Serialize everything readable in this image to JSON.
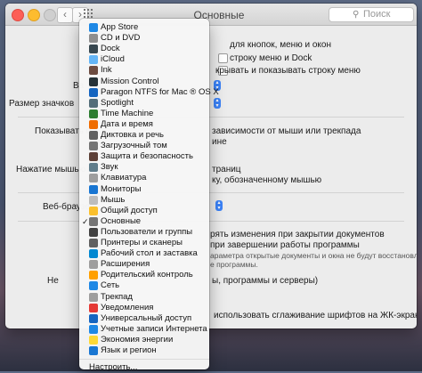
{
  "window": {
    "title": "Основные",
    "search_placeholder": "Поиск"
  },
  "pane": {
    "appearance_hint": "для кнопок, меню и окон",
    "dark_menu": "строку меню и Dock",
    "autohide": "крывать и показывать строку меню",
    "highlight_label": "Ва",
    "sidebar_size_label": "Размер значков",
    "scroll_label": "Показывать п",
    "scroll_value": "зависимости от мыши или трекпада",
    "scroll_value2": "ине",
    "click_label": "Нажатие мышью по",
    "click_value": "траниц",
    "click_value2": "ку, обозначенному мышью",
    "browser_label": "Веб-браузе",
    "ask_save": "рять изменения при закрытии документов",
    "close_windows": "при завершении работы программы",
    "restore_note_1": "араметра открытые документы и окна не будут восстановлены при",
    "restore_note_2": "е программы.",
    "recent_label": "Не",
    "recent_value": "ы, программы и серверы)",
    "font_smoothing": "использовать сглаживание шрифтов на ЖК-экране"
  },
  "menu": {
    "items": [
      {
        "label": "App Store",
        "icon": "app-store-icon",
        "color": "#1e88e5"
      },
      {
        "label": "CD и DVD",
        "icon": "cd-dvd-icon",
        "color": "#8e8e8e"
      },
      {
        "label": "Dock",
        "icon": "dock-icon",
        "color": "#37474f"
      },
      {
        "label": "iCloud",
        "icon": "icloud-icon",
        "color": "#64b5f6"
      },
      {
        "label": "Ink",
        "icon": "ink-icon",
        "color": "#6d4c41"
      },
      {
        "label": "Mission Control",
        "icon": "mission-control-icon",
        "color": "#263238"
      },
      {
        "label": "Paragon NTFS for Mac ® OS X",
        "icon": "paragon-ntfs-icon",
        "color": "#1565c0"
      },
      {
        "label": "Spotlight",
        "icon": "spotlight-icon",
        "color": "#546e7a"
      },
      {
        "label": "Time Machine",
        "icon": "time-machine-icon",
        "color": "#2e7d32"
      },
      {
        "label": "Дата и время",
        "icon": "date-time-icon",
        "color": "#ef6c00"
      },
      {
        "label": "Диктовка и речь",
        "icon": "dictation-icon",
        "color": "#616161"
      },
      {
        "label": "Загрузочный том",
        "icon": "startup-disk-icon",
        "color": "#757575"
      },
      {
        "label": "Защита и безопасность",
        "icon": "security-icon",
        "color": "#5d4037"
      },
      {
        "label": "Звук",
        "icon": "sound-icon",
        "color": "#607d8b"
      },
      {
        "label": "Клавиатура",
        "icon": "keyboard-icon",
        "color": "#9e9e9e"
      },
      {
        "label": "Мониторы",
        "icon": "displays-icon",
        "color": "#1976d2"
      },
      {
        "label": "Мышь",
        "icon": "mouse-icon",
        "color": "#bdbdbd"
      },
      {
        "label": "Общий доступ",
        "icon": "sharing-icon",
        "color": "#fbc02d"
      },
      {
        "label": "Основные",
        "icon": "general-icon",
        "color": "#757575",
        "checked": "✓"
      },
      {
        "label": "Пользователи и группы",
        "icon": "users-groups-icon",
        "color": "#424242"
      },
      {
        "label": "Принтеры и сканеры",
        "icon": "printers-icon",
        "color": "#616161"
      },
      {
        "label": "Рабочий стол и заставка",
        "icon": "desktop-icon",
        "color": "#0288d1"
      },
      {
        "label": "Расширения",
        "icon": "extensions-icon",
        "color": "#9e9e9e"
      },
      {
        "label": "Родительский контроль",
        "icon": "parental-controls-icon",
        "color": "#ffa000"
      },
      {
        "label": "Сеть",
        "icon": "network-icon",
        "color": "#1e88e5"
      },
      {
        "label": "Трекпад",
        "icon": "trackpad-icon",
        "color": "#9e9e9e"
      },
      {
        "label": "Уведомления",
        "icon": "notifications-icon",
        "color": "#e53935"
      },
      {
        "label": "Универсальный доступ",
        "icon": "accessibility-icon",
        "color": "#1565c0"
      },
      {
        "label": "Учетные записи Интернета",
        "icon": "internet-accounts-icon",
        "color": "#1e88e5"
      },
      {
        "label": "Экономия энергии",
        "icon": "energy-saver-icon",
        "color": "#fdd835"
      },
      {
        "label": "Язык и регион",
        "icon": "language-region-icon",
        "color": "#1976d2"
      }
    ],
    "customize": "Настроить..."
  }
}
